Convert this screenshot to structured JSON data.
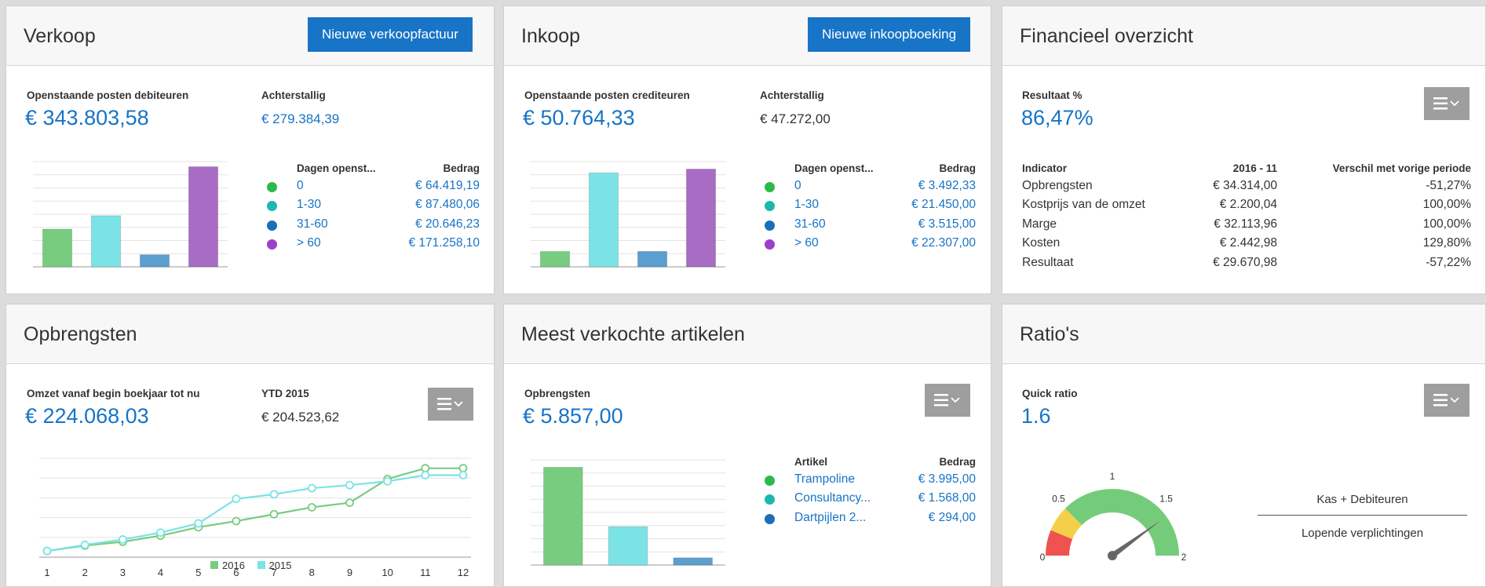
{
  "colors": {
    "accent": "#1774c6",
    "green": "#78cc80",
    "cyan": "#7be3e6",
    "blue": "#5b9ed0",
    "purple": "#a86cc4",
    "dot_green": "#2bb94a",
    "dot_teal": "#1cb8b0",
    "dot_blue": "#1a6fb8",
    "dot_purple": "#9b3fcb",
    "gauge_red": "#ef5350",
    "gauge_yellow": "#f4d04a",
    "gauge_green": "#74cc7a"
  },
  "verkoop": {
    "title": "Verkoop",
    "button": "Nieuwe verkoopfactuur",
    "open_label": "Openstaande posten debiteuren",
    "open_value": "€ 343.803,58",
    "overdue_label": "Achterstallig",
    "overdue_value": "€ 279.384,39",
    "col_days": "Dagen openst...",
    "col_amount": "Bedrag",
    "rows": [
      {
        "label": "0",
        "amount": "€ 64.419,19"
      },
      {
        "label": "1-30",
        "amount": "€ 87.480,06"
      },
      {
        "label": "31-60",
        "amount": "€ 20.646,23"
      },
      {
        "label": "> 60",
        "amount": "€ 171.258,10"
      }
    ]
  },
  "inkoop": {
    "title": "Inkoop",
    "button": "Nieuwe inkoopboeking",
    "open_label": "Openstaande posten crediteuren",
    "open_value": "€ 50.764,33",
    "overdue_label": "Achterstallig",
    "overdue_value": "€ 47.272,00",
    "col_days": "Dagen openst...",
    "col_amount": "Bedrag",
    "rows": [
      {
        "label": "0",
        "amount": "€ 3.492,33"
      },
      {
        "label": "1-30",
        "amount": "€ 21.450,00"
      },
      {
        "label": "31-60",
        "amount": "€ 3.515,00"
      },
      {
        "label": "> 60",
        "amount": "€ 22.307,00"
      }
    ]
  },
  "financieel": {
    "title": "Financieel overzicht",
    "result_label": "Resultaat %",
    "result_value": "86,47%",
    "col_indicator": "Indicator",
    "col_period": "2016 - 11",
    "col_diff": "Verschil met vorige periode",
    "rows": [
      {
        "name": "Opbrengsten",
        "value": "€ 34.314,00",
        "diff": "-51,27%"
      },
      {
        "name": "Kostprijs van de omzet",
        "value": "€ 2.200,04",
        "diff": "100,00%"
      },
      {
        "name": "Marge",
        "value": "€ 32.113,96",
        "diff": "100,00%"
      },
      {
        "name": "Kosten",
        "value": "€ 2.442,98",
        "diff": "129,80%"
      },
      {
        "name": "Resultaat",
        "value": "€ 29.670,98",
        "diff": "-57,22%"
      }
    ]
  },
  "opbrengsten": {
    "title": "Opbrengsten",
    "omzet_label": "Omzet vanaf begin boekjaar tot nu",
    "omzet_value": "€ 224.068,03",
    "ytd_label": "YTD 2015",
    "ytd_value": "€ 204.523,62"
  },
  "artikelen": {
    "title": "Meest verkochte artikelen",
    "opbr_label": "Opbrengsten",
    "opbr_value": "€ 5.857,00",
    "col_item": "Artikel",
    "col_amount": "Bedrag",
    "rows": [
      {
        "label": "Trampoline",
        "amount": "€ 3.995,00"
      },
      {
        "label": "Consultancy...",
        "amount": "€ 1.568,00"
      },
      {
        "label": "Dartpijlen 2...",
        "amount": "€ 294,00"
      }
    ]
  },
  "ratios": {
    "title": "Ratio's",
    "quick_label": "Quick ratio",
    "quick_value": "1.6",
    "numerator": "Kas + Debiteuren",
    "denominator": "Lopende verplichtingen",
    "gauge_ticks": [
      "0",
      "0.5",
      "1",
      "1.5",
      "2"
    ]
  },
  "chart_data": [
    {
      "type": "bar",
      "categories": [
        "0",
        "1-30",
        "31-60",
        "> 60"
      ],
      "values": [
        64419.19,
        87480.06,
        20646.23,
        171258.1
      ],
      "ylim": [
        0,
        180000
      ]
    },
    {
      "type": "bar",
      "categories": [
        "0",
        "1-30",
        "31-60",
        "> 60"
      ],
      "values": [
        3492.33,
        21450.0,
        3515.0,
        22307.0
      ],
      "ylim": [
        0,
        24000
      ]
    },
    {
      "type": "line",
      "x": [
        1,
        2,
        3,
        4,
        5,
        6,
        7,
        8,
        9,
        10,
        11,
        12
      ],
      "series": [
        {
          "name": "2016",
          "values": [
            4,
            11,
            16,
            24,
            35,
            43,
            52,
            61,
            67,
            98,
            112,
            112
          ]
        },
        {
          "name": "2015",
          "values": [
            4,
            12,
            19,
            28,
            40,
            72,
            78,
            86,
            90,
            95,
            103,
            103
          ]
        }
      ],
      "ylim": [
        0,
        125
      ],
      "legend": "bottom"
    },
    {
      "type": "bar",
      "categories": [
        "Trampoline",
        "Consultancy...",
        "Dartpijlen 2..."
      ],
      "values": [
        3995.0,
        1568.0,
        294.0
      ],
      "ylim": [
        0,
        4300
      ]
    },
    {
      "type": "gauge",
      "value": 1.6,
      "range": [
        0,
        2
      ],
      "bands": [
        [
          0,
          0.25
        ],
        [
          0.25,
          0.5
        ],
        [
          0.5,
          2
        ]
      ]
    }
  ]
}
